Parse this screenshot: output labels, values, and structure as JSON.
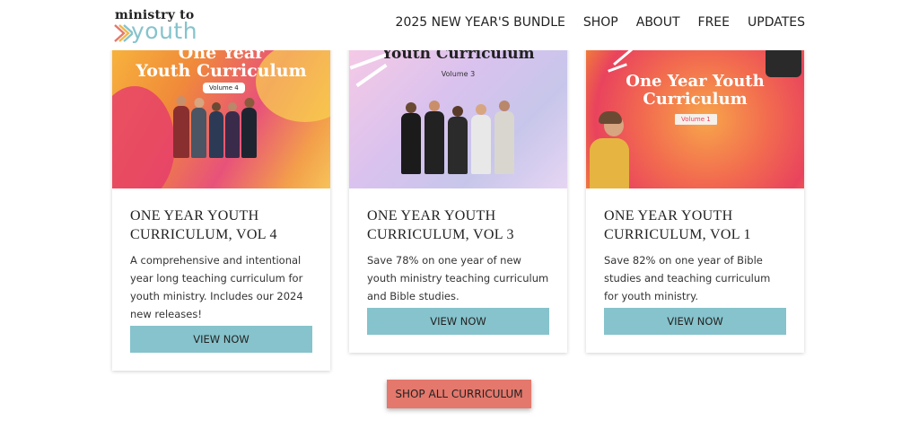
{
  "logo": {
    "line1": "ministry to",
    "line2": "youth"
  },
  "nav": [
    {
      "label": "2025 NEW YEAR'S BUNDLE"
    },
    {
      "label": "SHOP"
    },
    {
      "label": "ABOUT"
    },
    {
      "label": "FREE"
    },
    {
      "label": "UPDATES"
    }
  ],
  "cards": [
    {
      "image_title_line1": "One Year",
      "image_title_line2": "Youth Curriculum",
      "image_volume": "Volume 4",
      "title": "ONE YEAR YOUTH CURRICULUM, VOL 4",
      "description": "A comprehensive and intentional year long teaching curriculum for youth ministry. Includes our 2024 new releases!",
      "button": "VIEW NOW"
    },
    {
      "image_title_line1": "Youth Curriculum",
      "image_volume": "Volume 3",
      "title": "ONE YEAR YOUTH CURRICULUM, VOL 3",
      "description": "Save 78% on one year of new youth ministry teaching curriculum and Bible studies.",
      "button": "VIEW NOW"
    },
    {
      "image_title_line1": "One Year Youth",
      "image_title_line2": "Curriculum",
      "image_volume": "Volume 1",
      "title": "ONE YEAR YOUTH CURRICULUM, VOL 1",
      "description": "Save 82% on one year of Bible studies and teaching curriculum for youth ministry.",
      "button": "VIEW NOW"
    }
  ],
  "shop_all": "SHOP ALL CURRICULUM",
  "colors": {
    "accent": "#86c3cc",
    "shop_button": "#e4786c"
  }
}
